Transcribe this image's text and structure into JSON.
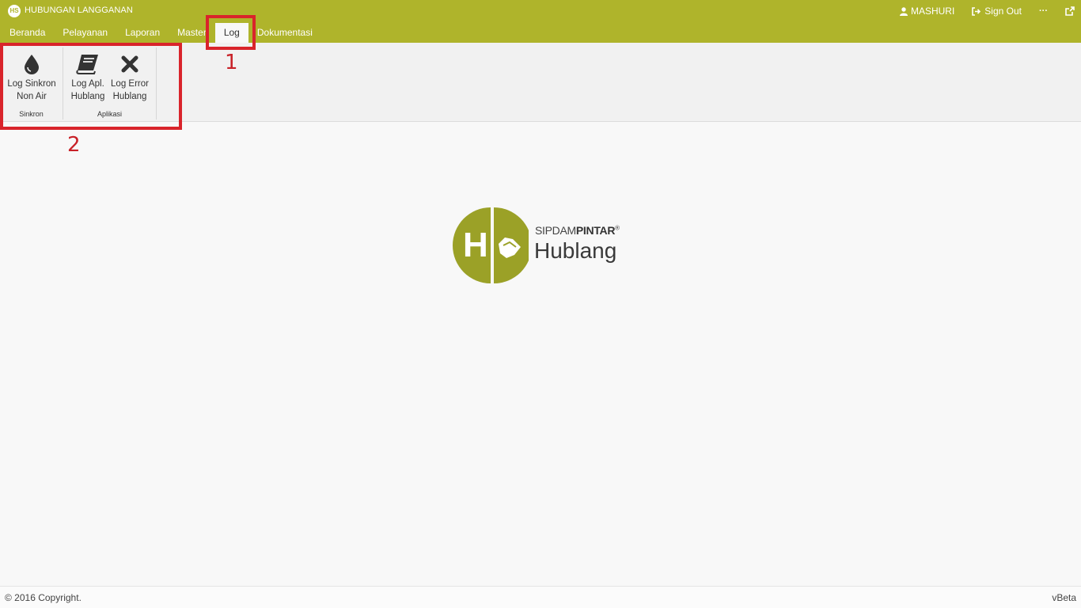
{
  "app": {
    "logo_text": "HS",
    "title": "HUBUNGAN LANGGANAN"
  },
  "user_menu": {
    "username": "MASHURI",
    "signout": "Sign Out",
    "more": "···"
  },
  "tabs": [
    {
      "label": "Beranda"
    },
    {
      "label": "Pelayanan"
    },
    {
      "label": "Laporan"
    },
    {
      "label": "Master"
    },
    {
      "label": "Log"
    },
    {
      "label": "Dokumentasi"
    }
  ],
  "ribbon": {
    "groups": [
      {
        "label": "Sinkron",
        "buttons": [
          {
            "label": "Log Sinkron\nNon Air",
            "icon": "water-drop-icon"
          }
        ]
      },
      {
        "label": "Aplikasi",
        "buttons": [
          {
            "label": "Log Apl.\nHublang",
            "icon": "book-icon"
          },
          {
            "label": "Log Error\nHublang",
            "icon": "x-icon"
          }
        ]
      }
    ]
  },
  "annotations": {
    "one": "1",
    "two": "2"
  },
  "brand": {
    "circle_letter": "H",
    "line1_light": "SIPDAM",
    "line1_bold": "PINTAR",
    "reg": "®",
    "line2": "Hublang"
  },
  "footer": {
    "copyright": "© 2016 Copyright.",
    "version": "vBeta"
  },
  "colors": {
    "accent": "#afb42b",
    "highlight": "#d9242b"
  }
}
